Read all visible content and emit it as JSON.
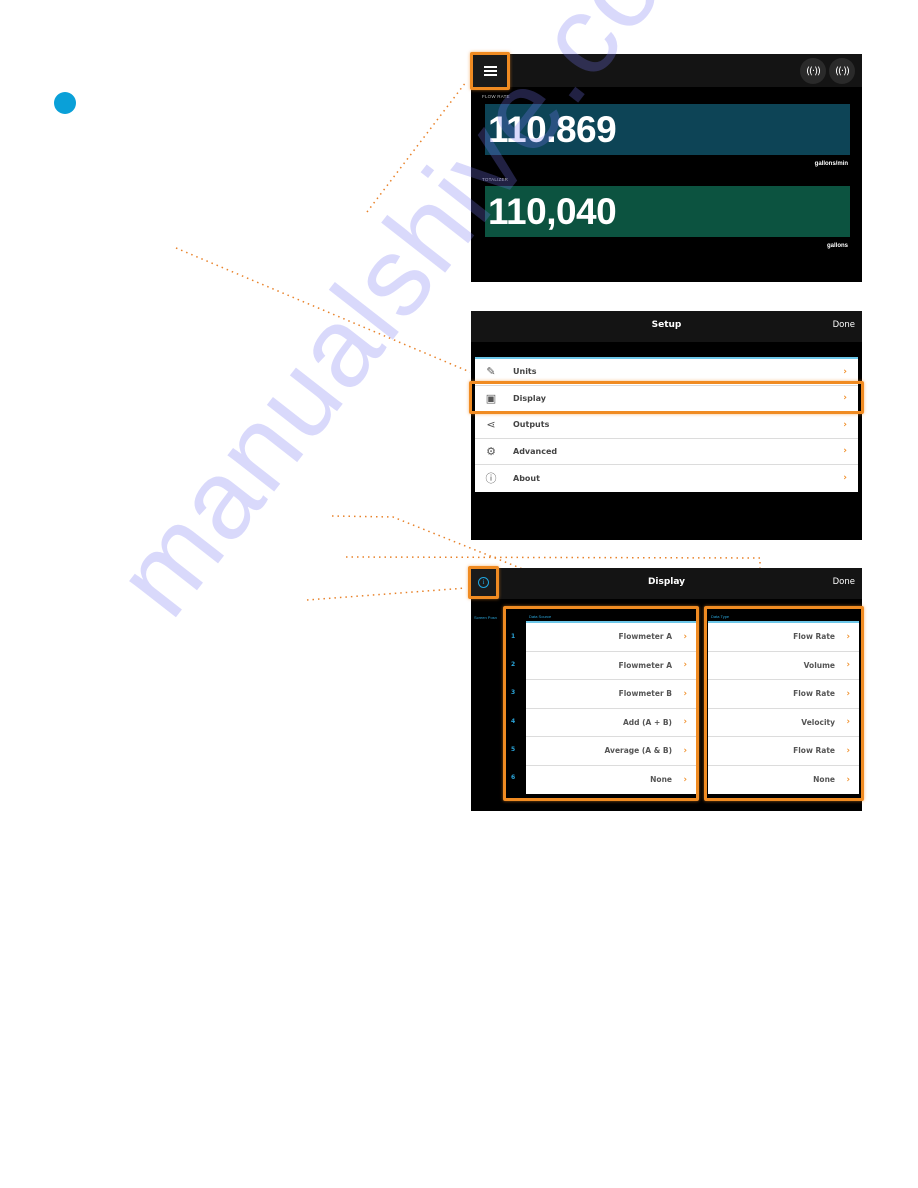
{
  "step_marker": {
    "color": "#0aa0d8"
  },
  "watermark": "manualshive.com",
  "colors": {
    "accent_highlight": "#f08b22",
    "flow_panel": "#0d4456",
    "total_panel": "#0c5340",
    "info_blue": "#2aa4d8"
  },
  "screen_main": {
    "menu_icon": "hamburger-menu-icon",
    "signal_icons": [
      "wireless-signal-icon",
      "wireless-signal-icon"
    ],
    "signal_glyph": "((·))",
    "flow_rate": {
      "label": "FLOW RATE",
      "value": "110.869",
      "unit": "gallons/min"
    },
    "totalizer": {
      "label": "TOTALIZER",
      "value": "110,040",
      "unit": "gallons"
    }
  },
  "screen_setup": {
    "title": "Setup",
    "done_label": "Done",
    "items": [
      {
        "label": "Units",
        "icon": "ruler-icon",
        "glyph": "✎"
      },
      {
        "label": "Display",
        "icon": "display-device-icon",
        "glyph": "▣"
      },
      {
        "label": "Outputs",
        "icon": "share-nodes-icon",
        "glyph": "⋖"
      },
      {
        "label": "Advanced",
        "icon": "gear-icon",
        "glyph": "⚙"
      },
      {
        "label": "About",
        "icon": "info-box-icon",
        "glyph": "ⓘ"
      }
    ],
    "chevron": "›"
  },
  "screen_display": {
    "title": "Display",
    "done_label": "Done",
    "info_glyph": "i",
    "headers": {
      "position": "Screen Posn",
      "source": "Data Source",
      "type": "Data Type"
    },
    "rows": [
      {
        "pos": "1",
        "source": "Flowmeter A",
        "type": "Flow Rate"
      },
      {
        "pos": "2",
        "source": "Flowmeter A",
        "type": "Volume"
      },
      {
        "pos": "3",
        "source": "Flowmeter B",
        "type": "Flow Rate"
      },
      {
        "pos": "4",
        "source": "Add (A + B)",
        "type": "Velocity"
      },
      {
        "pos": "5",
        "source": "Average (A & B)",
        "type": "Flow Rate"
      },
      {
        "pos": "6",
        "source": "None",
        "type": "None"
      }
    ],
    "chevron": "›"
  }
}
